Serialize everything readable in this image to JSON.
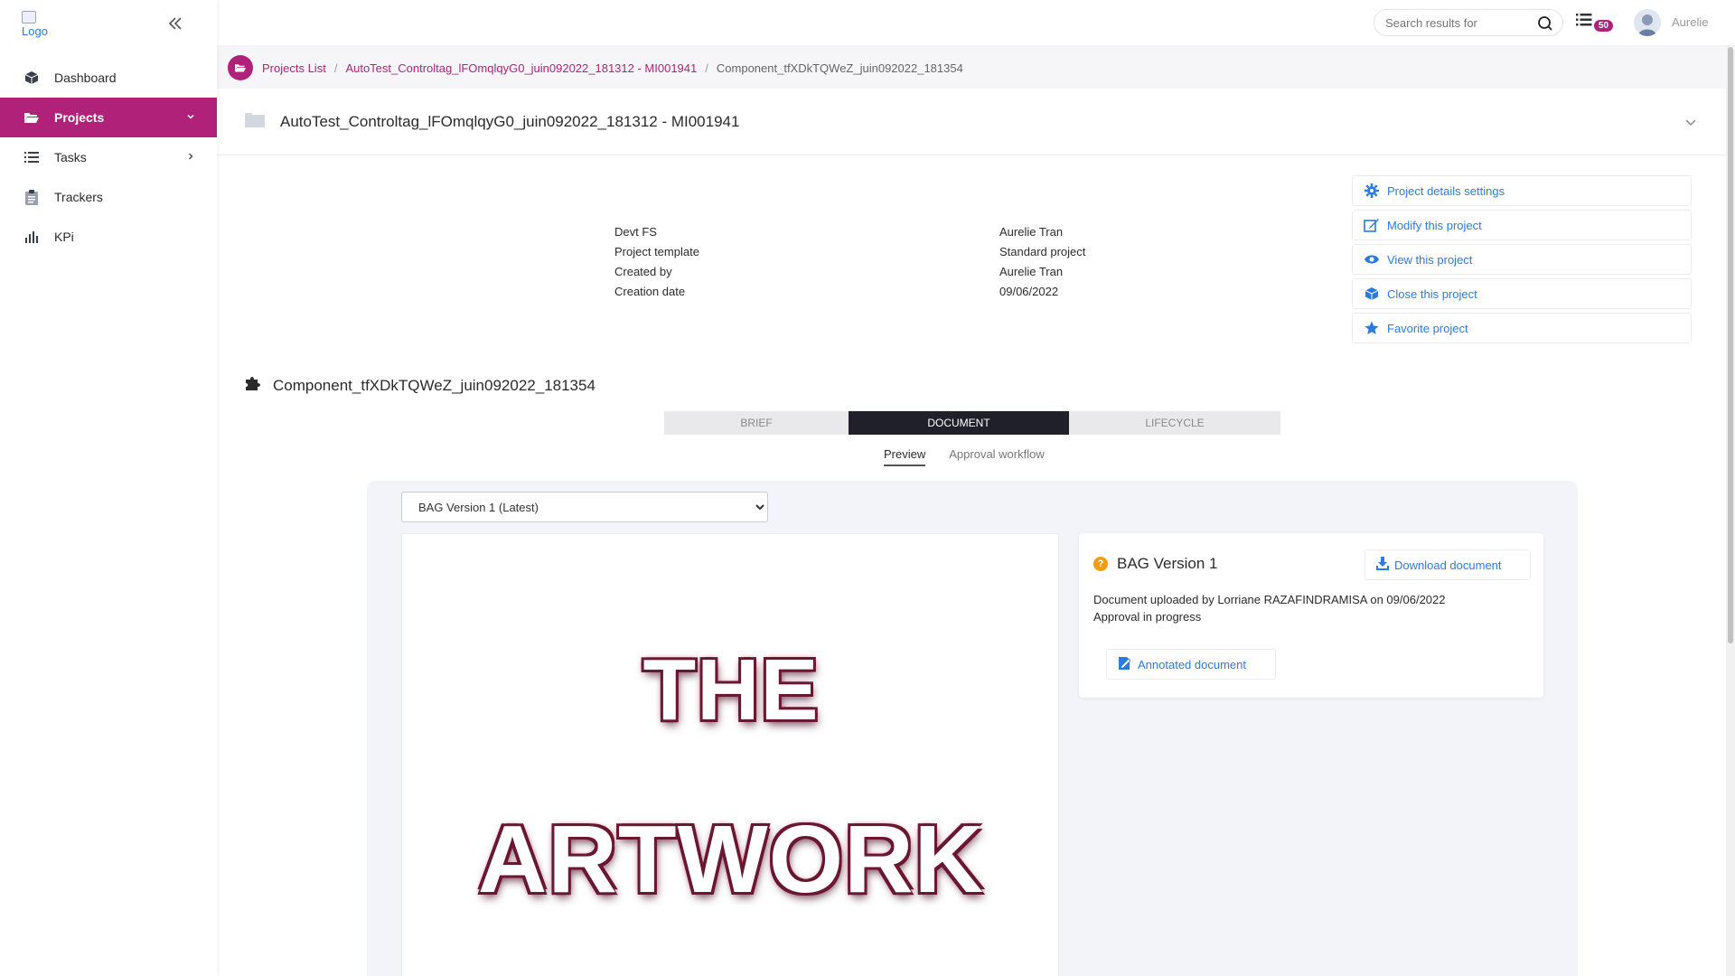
{
  "sidebar": {
    "logo_alt": "Logo",
    "items": [
      {
        "label": "Dashboard",
        "icon": "cube-icon"
      },
      {
        "label": "Projects",
        "icon": "folder-open-icon",
        "active": true
      },
      {
        "label": "Tasks",
        "icon": "list-icon"
      },
      {
        "label": "Trackers",
        "icon": "clipboard-icon"
      },
      {
        "label": "KPi",
        "icon": "bar-chart-icon"
      }
    ]
  },
  "topbar": {
    "search_placeholder": "Search results for",
    "tasks_badge": "50",
    "user_name": "Aurelie"
  },
  "breadcrumb": {
    "items": [
      "Projects List",
      "AutoTest_Controltag_lFOmqlqyG0_juin092022_181312 - MI001941",
      "Component_tfXDkTQWeZ_juin092022_181354"
    ]
  },
  "project": {
    "title": "AutoTest_Controltag_lFOmqlqyG0_juin092022_181312 - MI001941",
    "details": [
      {
        "key": "Devt FS",
        "value": "Aurelie Tran"
      },
      {
        "key": "Project template",
        "value": "Standard project"
      },
      {
        "key": "Created by",
        "value": "Aurelie Tran"
      },
      {
        "key": "Creation date",
        "value": "09/06/2022"
      }
    ],
    "actions": [
      {
        "label": "Project details settings",
        "icon": "gear-icon"
      },
      {
        "label": "Modify this project",
        "icon": "edit-icon"
      },
      {
        "label": "View this project",
        "icon": "eye-icon"
      },
      {
        "label": "Close this project",
        "icon": "box-icon"
      },
      {
        "label": "Favorite project",
        "icon": "star-icon"
      }
    ]
  },
  "component": {
    "title": "Component_tfXDkTQWeZ_juin092022_181354",
    "tabs": [
      "BRIEF",
      "DOCUMENT",
      "LIFECYCLE"
    ],
    "active_tab": "DOCUMENT",
    "subtabs": [
      "Preview",
      "Approval workflow"
    ],
    "active_subtab": "Preview"
  },
  "document": {
    "version_options": [
      "BAG Version 1 (Latest)"
    ],
    "selected_version": "BAG Version 1 (Latest)",
    "artwork_line1": "THE",
    "artwork_line2": "ARTWORK",
    "card_title": "BAG Version 1",
    "download_label": "Download document",
    "uploaded_text": "Document uploaded by Lorriane RAZAFINDRAMISA on 09/06/2022",
    "status_text": "Approval in progress",
    "annotated_label": "Annotated document"
  },
  "colors": {
    "brand": "#b0227a",
    "link": "#2a7ae2",
    "tab_active": "#1f2029",
    "pending": "#f39c12"
  }
}
